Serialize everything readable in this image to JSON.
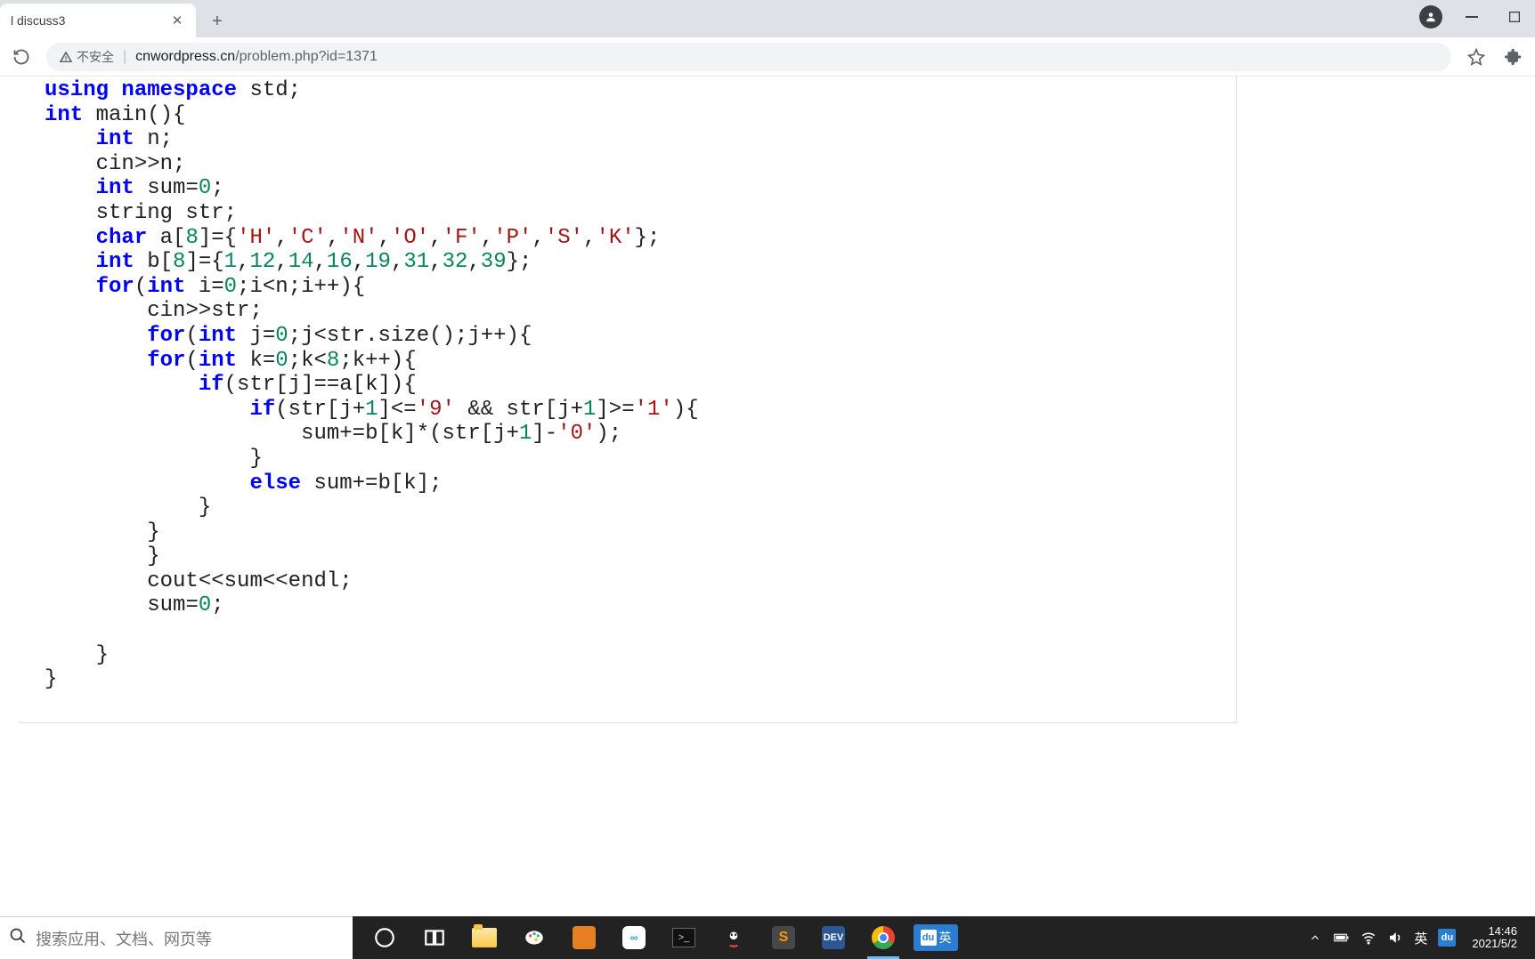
{
  "tab": {
    "title": "l discuss3"
  },
  "address": {
    "security_label": "不安全",
    "host": "cnwordpress.cn",
    "path": "/problem.php?id=1371"
  },
  "code": {
    "lines": [
      {
        "t": [
          [
            "kw",
            "using"
          ],
          [
            "sp",
            " "
          ],
          [
            "kw",
            "namespace"
          ],
          [
            "sp",
            " "
          ],
          [
            "id",
            "std"
          ],
          [
            "op",
            ";"
          ]
        ]
      },
      {
        "t": [
          [
            "kw",
            "int"
          ],
          [
            "sp",
            " "
          ],
          [
            "id",
            "main"
          ],
          [
            "op",
            "(){"
          ]
        ]
      },
      {
        "t": [
          [
            "sp",
            "    "
          ],
          [
            "kw",
            "int"
          ],
          [
            "sp",
            " "
          ],
          [
            "id",
            "n"
          ],
          [
            "op",
            ";"
          ]
        ]
      },
      {
        "t": [
          [
            "sp",
            "    "
          ],
          [
            "id",
            "cin"
          ],
          [
            "op",
            ">>"
          ],
          [
            "id",
            "n"
          ],
          [
            "op",
            ";"
          ]
        ]
      },
      {
        "t": [
          [
            "sp",
            "    "
          ],
          [
            "kw",
            "int"
          ],
          [
            "sp",
            " "
          ],
          [
            "id",
            "sum"
          ],
          [
            "op",
            "="
          ],
          [
            "num",
            "0"
          ],
          [
            "op",
            ";"
          ]
        ]
      },
      {
        "t": [
          [
            "sp",
            "    "
          ],
          [
            "id",
            "string str"
          ],
          [
            "op",
            ";"
          ]
        ]
      },
      {
        "t": [
          [
            "sp",
            "    "
          ],
          [
            "kw",
            "char"
          ],
          [
            "sp",
            " "
          ],
          [
            "id",
            "a"
          ],
          [
            "op",
            "["
          ],
          [
            "num",
            "8"
          ],
          [
            "op",
            "]={"
          ],
          [
            "ch",
            "'H'"
          ],
          [
            "op",
            ","
          ],
          [
            "ch",
            "'C'"
          ],
          [
            "op",
            ","
          ],
          [
            "ch",
            "'N'"
          ],
          [
            "op",
            ","
          ],
          [
            "ch",
            "'O'"
          ],
          [
            "op",
            ","
          ],
          [
            "ch",
            "'F'"
          ],
          [
            "op",
            ","
          ],
          [
            "ch",
            "'P'"
          ],
          [
            "op",
            ","
          ],
          [
            "ch",
            "'S'"
          ],
          [
            "op",
            ","
          ],
          [
            "ch",
            "'K'"
          ],
          [
            "op",
            "};"
          ]
        ]
      },
      {
        "t": [
          [
            "sp",
            "    "
          ],
          [
            "kw",
            "int"
          ],
          [
            "sp",
            " "
          ],
          [
            "id",
            "b"
          ],
          [
            "op",
            "["
          ],
          [
            "num",
            "8"
          ],
          [
            "op",
            "]={"
          ],
          [
            "num",
            "1"
          ],
          [
            "op",
            ","
          ],
          [
            "num",
            "12"
          ],
          [
            "op",
            ","
          ],
          [
            "num",
            "14"
          ],
          [
            "op",
            ","
          ],
          [
            "num",
            "16"
          ],
          [
            "op",
            ","
          ],
          [
            "num",
            "19"
          ],
          [
            "op",
            ","
          ],
          [
            "num",
            "31"
          ],
          [
            "op",
            ","
          ],
          [
            "num",
            "32"
          ],
          [
            "op",
            ","
          ],
          [
            "num",
            "39"
          ],
          [
            "op",
            "};"
          ]
        ]
      },
      {
        "t": [
          [
            "sp",
            "    "
          ],
          [
            "kw",
            "for"
          ],
          [
            "op",
            "("
          ],
          [
            "kw",
            "int"
          ],
          [
            "sp",
            " "
          ],
          [
            "id",
            "i"
          ],
          [
            "op",
            "="
          ],
          [
            "num",
            "0"
          ],
          [
            "op",
            ";"
          ],
          [
            "id",
            "i"
          ],
          [
            "op",
            "<"
          ],
          [
            "id",
            "n"
          ],
          [
            "op",
            ";"
          ],
          [
            "id",
            "i"
          ],
          [
            "op",
            "++){"
          ]
        ]
      },
      {
        "t": [
          [
            "sp",
            "        "
          ],
          [
            "id",
            "cin"
          ],
          [
            "op",
            ">>"
          ],
          [
            "id",
            "str"
          ],
          [
            "op",
            ";"
          ]
        ]
      },
      {
        "t": [
          [
            "sp",
            "        "
          ],
          [
            "kw",
            "for"
          ],
          [
            "op",
            "("
          ],
          [
            "kw",
            "int"
          ],
          [
            "sp",
            " "
          ],
          [
            "id",
            "j"
          ],
          [
            "op",
            "="
          ],
          [
            "num",
            "0"
          ],
          [
            "op",
            ";"
          ],
          [
            "id",
            "j"
          ],
          [
            "op",
            "<"
          ],
          [
            "id",
            "str.size"
          ],
          [
            "op",
            "();"
          ],
          [
            "id",
            "j"
          ],
          [
            "op",
            "++){"
          ]
        ]
      },
      {
        "t": [
          [
            "sp",
            "        "
          ],
          [
            "kw",
            "for"
          ],
          [
            "op",
            "("
          ],
          [
            "kw",
            "int"
          ],
          [
            "sp",
            " "
          ],
          [
            "id",
            "k"
          ],
          [
            "op",
            "="
          ],
          [
            "num",
            "0"
          ],
          [
            "op",
            ";"
          ],
          [
            "id",
            "k"
          ],
          [
            "op",
            "<"
          ],
          [
            "num",
            "8"
          ],
          [
            "op",
            ";"
          ],
          [
            "id",
            "k"
          ],
          [
            "op",
            "++){"
          ]
        ]
      },
      {
        "t": [
          [
            "sp",
            "            "
          ],
          [
            "kw",
            "if"
          ],
          [
            "op",
            "("
          ],
          [
            "id",
            "str"
          ],
          [
            "op",
            "["
          ],
          [
            "id",
            "j"
          ],
          [
            "op",
            "]=="
          ],
          [
            "id",
            "a"
          ],
          [
            "op",
            "["
          ],
          [
            "id",
            "k"
          ],
          [
            "op",
            "]){"
          ]
        ]
      },
      {
        "t": [
          [
            "sp",
            "                "
          ],
          [
            "kw",
            "if"
          ],
          [
            "op",
            "("
          ],
          [
            "id",
            "str"
          ],
          [
            "op",
            "["
          ],
          [
            "id",
            "j"
          ],
          [
            "op",
            "+"
          ],
          [
            "num",
            "1"
          ],
          [
            "op",
            "]<="
          ],
          [
            "ch",
            "'9'"
          ],
          [
            "sp",
            " "
          ],
          [
            "op",
            "&&"
          ],
          [
            "sp",
            " "
          ],
          [
            "id",
            "str"
          ],
          [
            "op",
            "["
          ],
          [
            "id",
            "j"
          ],
          [
            "op",
            "+"
          ],
          [
            "num",
            "1"
          ],
          [
            "op",
            "]>="
          ],
          [
            "ch",
            "'1'"
          ],
          [
            "op",
            "){"
          ]
        ]
      },
      {
        "t": [
          [
            "sp",
            "                    "
          ],
          [
            "id",
            "sum"
          ],
          [
            "op",
            "+="
          ],
          [
            "id",
            "b"
          ],
          [
            "op",
            "["
          ],
          [
            "id",
            "k"
          ],
          [
            "op",
            "]*("
          ],
          [
            "id",
            "str"
          ],
          [
            "op",
            "["
          ],
          [
            "id",
            "j"
          ],
          [
            "op",
            "+"
          ],
          [
            "num",
            "1"
          ],
          [
            "op",
            "]-"
          ],
          [
            "ch",
            "'0'"
          ],
          [
            "op",
            ");"
          ]
        ]
      },
      {
        "t": [
          [
            "sp",
            "                "
          ],
          [
            "op",
            "}"
          ]
        ]
      },
      {
        "t": [
          [
            "sp",
            "                "
          ],
          [
            "kw",
            "else"
          ],
          [
            "sp",
            " "
          ],
          [
            "id",
            "sum"
          ],
          [
            "op",
            "+="
          ],
          [
            "id",
            "b"
          ],
          [
            "op",
            "["
          ],
          [
            "id",
            "k"
          ],
          [
            "op",
            "];"
          ]
        ]
      },
      {
        "t": [
          [
            "sp",
            "            "
          ],
          [
            "op",
            "}"
          ]
        ]
      },
      {
        "t": [
          [
            "sp",
            "        "
          ],
          [
            "op",
            "}"
          ]
        ]
      },
      {
        "t": [
          [
            "sp",
            "        "
          ],
          [
            "op",
            "}"
          ]
        ]
      },
      {
        "t": [
          [
            "sp",
            "        "
          ],
          [
            "id",
            "cout"
          ],
          [
            "op",
            "<<"
          ],
          [
            "id",
            "sum"
          ],
          [
            "op",
            "<<"
          ],
          [
            "id",
            "endl"
          ],
          [
            "op",
            ";"
          ]
        ]
      },
      {
        "t": [
          [
            "sp",
            "        "
          ],
          [
            "id",
            "sum"
          ],
          [
            "op",
            "="
          ],
          [
            "num",
            "0"
          ],
          [
            "op",
            ";"
          ]
        ]
      },
      {
        "t": [
          [
            "sp",
            ""
          ]
        ]
      },
      {
        "t": [
          [
            "sp",
            "    "
          ],
          [
            "op",
            "}"
          ]
        ]
      },
      {
        "t": [
          [
            "op",
            "}"
          ]
        ]
      }
    ]
  },
  "taskbar": {
    "search_placeholder": "搜索应用、文档、网页等",
    "ime_badge": "du",
    "ime_lang": "英",
    "tray_lang": "英",
    "tray_badge": "du",
    "time": "14:46",
    "date": "2021/5/2"
  }
}
